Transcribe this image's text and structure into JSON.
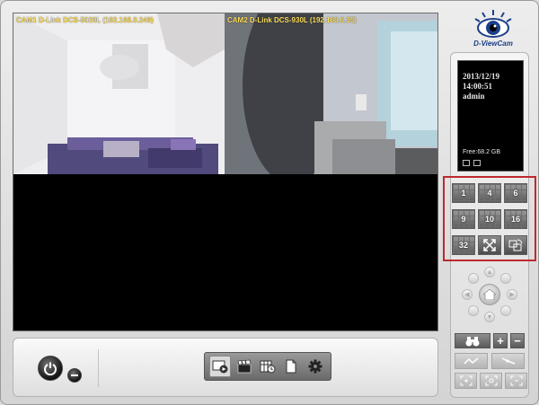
{
  "cameras": [
    {
      "label": "CAM1 D-Link DCS-5020L (192.168.0.249)"
    },
    {
      "label": "CAM2 D-Link DCS-930L (192.168.0.35)"
    }
  ],
  "logo": {
    "text": "D-ViewCam"
  },
  "info": {
    "date": "2013/12/19",
    "time": "14:00:51",
    "user": "admin",
    "free_space": "Free:68.2 GB"
  },
  "layouts": [
    "1",
    "4",
    "6",
    "9",
    "10",
    "16",
    "32"
  ],
  "toolbar": {
    "icons": [
      "playback-icon",
      "clapper-icon",
      "schedule-icon",
      "document-icon",
      "settings-gear-icon"
    ]
  },
  "colors": {
    "highlight": "#c0282d",
    "cam_label": "#ffe05a"
  }
}
